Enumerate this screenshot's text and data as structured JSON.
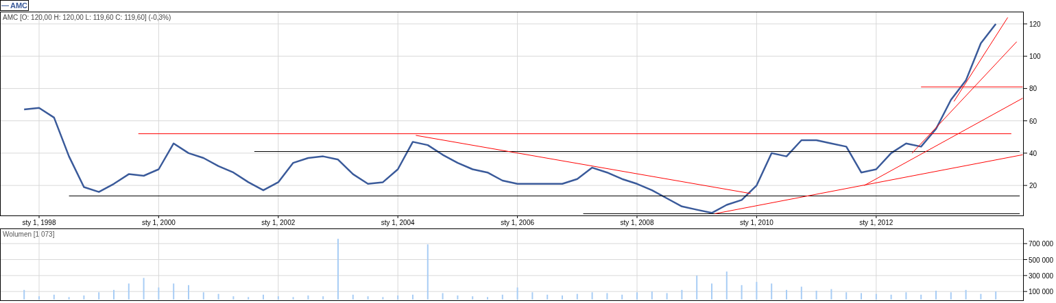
{
  "price_panel": {
    "header": "AMC [O: 120,00  H: 120,00  L: 119,60  C: 119,60] (-0,3%)",
    "chart_data": {
      "type": "line",
      "grid": true,
      "ylim": [
        1,
        127.6
      ],
      "yticks": [
        20,
        40,
        60,
        80,
        100,
        120
      ],
      "categories": [
        null,
        "sty 1, 1998",
        null,
        null,
        null,
        null,
        null,
        null,
        null,
        "sty 1, 2000",
        null,
        null,
        null,
        null,
        null,
        null,
        null,
        "sty 1, 2002",
        null,
        null,
        null,
        null,
        null,
        null,
        null,
        "sty 1, 2004",
        null,
        null,
        null,
        null,
        null,
        null,
        null,
        "sty 1, 2006",
        null,
        null,
        null,
        null,
        null,
        null,
        null,
        "sty 1, 2008",
        null,
        null,
        null,
        null,
        null,
        null,
        null,
        "sty 1, 2010",
        null,
        null,
        null,
        null,
        null,
        null,
        null,
        "sty 1, 2012",
        null,
        null,
        null,
        null,
        null,
        null,
        null,
        null
      ],
      "series": [
        {
          "name": "AMC",
          "color": "#3a5a9a",
          "values": [
            67,
            68,
            62,
            38,
            19,
            16,
            21,
            27,
            26,
            30,
            46,
            40,
            37,
            32,
            28,
            22,
            17,
            22,
            34,
            37,
            38,
            36,
            27,
            21,
            22,
            30,
            47,
            45,
            39,
            34,
            30,
            28,
            23,
            21,
            21,
            21,
            21,
            24,
            31,
            28,
            24,
            21,
            17,
            12,
            7,
            5,
            3,
            8,
            11,
            20,
            40,
            38,
            48,
            48,
            46,
            44,
            28,
            30,
            40,
            46,
            44,
            55,
            73,
            85,
            108,
            120
          ]
        }
      ]
    }
  },
  "volume_panel": {
    "reading": "[1 073]",
    "chart_data": {
      "type": "bar",
      "grid": true,
      "ylim": [
        -10000,
        890000
      ],
      "yticks": [
        {
          "value": 100000,
          "label": "100 000"
        },
        {
          "value": 300000,
          "label": "300 000"
        },
        {
          "value": 500000,
          "label": "500 000"
        },
        {
          "value": 700000,
          "label": "700 000"
        }
      ],
      "categories": [
        null,
        null,
        null,
        null,
        null,
        null,
        null,
        null,
        null,
        null,
        null,
        null,
        null,
        null,
        null,
        null,
        null,
        null,
        null,
        null,
        null,
        null,
        null,
        null,
        null,
        null,
        null,
        null,
        null,
        null,
        null,
        null,
        null,
        null,
        null,
        null,
        null,
        null,
        null,
        null,
        null,
        null,
        null,
        null,
        null,
        null,
        null,
        null,
        null,
        null,
        null,
        null,
        null,
        null,
        null,
        null,
        null,
        null,
        null,
        null,
        null,
        null,
        null,
        null,
        null,
        null
      ],
      "series": [
        {
          "name": "Wolumen",
          "color": "#a8cdf5",
          "values": [
            120000,
            40000,
            60000,
            30000,
            50000,
            90000,
            120000,
            200000,
            270000,
            150000,
            200000,
            180000,
            90000,
            70000,
            40000,
            30000,
            60000,
            40000,
            30000,
            50000,
            40000,
            760000,
            60000,
            40000,
            30000,
            50000,
            60000,
            690000,
            80000,
            50000,
            40000,
            30000,
            60000,
            150000,
            90000,
            60000,
            50000,
            70000,
            90000,
            80000,
            60000,
            90000,
            100000,
            80000,
            120000,
            300000,
            200000,
            350000,
            180000,
            220000,
            200000,
            120000,
            160000,
            110000,
            130000,
            90000,
            80000,
            70000,
            60000,
            90000,
            60000,
            110000,
            90000,
            120000,
            70000,
            100000
          ]
        }
      ]
    }
  }
}
